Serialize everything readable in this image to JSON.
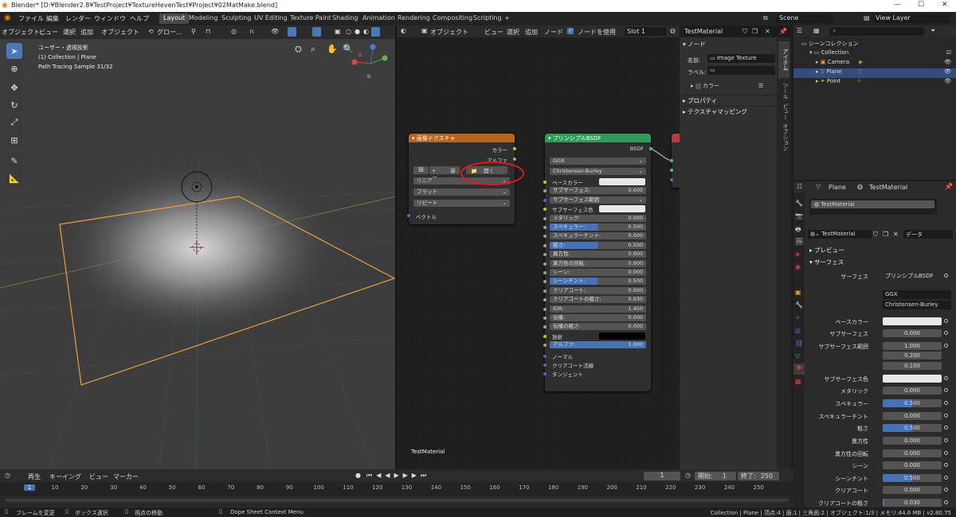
{
  "title_bar": {
    "title": "Blender* [D:¥Blender2.8¥TestProject¥TextureHevenTest¥Project¥02MatMake.blend]",
    "minimize": "—",
    "maximize": "☐",
    "close": "✕"
  },
  "menu": {
    "items": [
      "ファイル",
      "編集",
      "レンダー",
      "ウィンドウ",
      "ヘルプ"
    ],
    "workspaces": [
      "Layout",
      "Modeling",
      "Sculpting",
      "UV Editing",
      "Texture Paint",
      "Shading",
      "Animation",
      "Rendering",
      "Compositing",
      "Scripting",
      "+"
    ],
    "scene": "Scene",
    "view_layer": "View Layer"
  },
  "viewport": {
    "header": {
      "mode": "オブジェクト...",
      "view": "ビュー",
      "select": "選択",
      "add": "追加",
      "object": "オブジェクト",
      "orientation": "グロー..."
    },
    "overlay_lines": [
      "ユーザー・透視投影",
      "(1) Collection | Plane",
      "Path Tracing Sample 31/32"
    ]
  },
  "node_editor": {
    "header": {
      "type": "オブジェクト",
      "view": "ビュー",
      "select": "選択",
      "add": "追加",
      "node": "ノード",
      "use_nodes": "ノードを使用",
      "slot": "Slot 1",
      "material": "TestMaterial"
    },
    "footer_label": "TestMaterial",
    "image_texture_node": {
      "title": "画像テクスチャ",
      "out_color": "カラー",
      "out_alpha": "アルファ",
      "new_btn": "新規",
      "open_btn": "開く",
      "interpolation": "リニア",
      "projection": "フラット",
      "extension": "リピート",
      "in_vector": "ベクトル"
    },
    "bsdf_node": {
      "title": "プリンシプルBSDF",
      "out": "BSDF",
      "distribution": "GGX",
      "subsurface_method": "Christensen-Burley",
      "rows": [
        {
          "label": "ベースカラー",
          "value": "",
          "kind": "color"
        },
        {
          "label": "サブサーフェス:",
          "value": "0.000",
          "kind": "num"
        },
        {
          "label": "サブサーフェス範囲",
          "value": "",
          "kind": "drop"
        },
        {
          "label": "サブサーフェス色",
          "value": "",
          "kind": "color"
        },
        {
          "label": "メタリック:",
          "value": "0.000",
          "kind": "num"
        },
        {
          "label": "スペキュラー:",
          "value": "0.500",
          "kind": "bar"
        },
        {
          "label": "スペキュラーチント:",
          "value": "0.000",
          "kind": "num"
        },
        {
          "label": "粗さ:",
          "value": "0.500",
          "kind": "bar"
        },
        {
          "label": "異方性:",
          "value": "0.000",
          "kind": "num"
        },
        {
          "label": "異方性の回転:",
          "value": "0.000",
          "kind": "num"
        },
        {
          "label": "シーン:",
          "value": "0.000",
          "kind": "num"
        },
        {
          "label": "シーンチント:",
          "value": "0.500",
          "kind": "bar"
        },
        {
          "label": "クリアコート:",
          "value": "0.000",
          "kind": "num"
        },
        {
          "label": "クリアコートの粗さ:",
          "value": "0.030",
          "kind": "num"
        },
        {
          "label": "IOR:",
          "value": "1.450",
          "kind": "num"
        },
        {
          "label": "伝播:",
          "value": "0.000",
          "kind": "num"
        },
        {
          "label": "伝播の粗さ:",
          "value": "0.000",
          "kind": "num"
        },
        {
          "label": "放射",
          "value": "",
          "kind": "black"
        },
        {
          "label": "アルファ:",
          "value": "1.000",
          "kind": "full"
        }
      ],
      "inputs_plain": [
        "ノーマル",
        "クリアコート法線",
        "タンジェント"
      ]
    }
  },
  "n_panel": {
    "section": "ノード",
    "name_label": "名前:",
    "name_value": "Image Texture",
    "label_label": "ラベル:",
    "color": "カラー",
    "properties": "プロパティ",
    "texture_mapping": "テクスチャマッピング",
    "tabs": [
      "アイテム",
      "ツール",
      "ビュー",
      "オプション"
    ]
  },
  "outliner": {
    "root": "シーンコレクション",
    "rows": [
      {
        "name": "Collection"
      },
      {
        "name": "Camera"
      },
      {
        "name": "Plane"
      },
      {
        "name": "Point"
      }
    ]
  },
  "properties": {
    "object": "Plane",
    "material": "TestMaterial",
    "slot_item": "TestMaterial",
    "mat_name": "TestMaterial",
    "data": "データ",
    "preview": "プレビュー",
    "surface_section": "サーフェス",
    "surface_label": "サーフェス",
    "surface_value": "プリンシプルBSDF",
    "distribution": "GGX",
    "method": "Christensen-Burley",
    "rows": [
      {
        "label": "ベースカラー",
        "value": ""
      },
      {
        "label": "サブサーフェス",
        "value": "0.000"
      },
      {
        "label": "サブサーフェス範囲",
        "value": "1.000"
      },
      {
        "label": "",
        "value": "0.200"
      },
      {
        "label": "",
        "value": "0.100"
      },
      {
        "label": "サブサーフェス色",
        "value": ""
      },
      {
        "label": "メタリック",
        "value": "0.000"
      },
      {
        "label": "スペキュラー",
        "value": "0.500"
      },
      {
        "label": "スペキュラーチント",
        "value": "0.000"
      },
      {
        "label": "粗さ",
        "value": "0.500"
      },
      {
        "label": "異方性",
        "value": "0.000"
      },
      {
        "label": "異方性の回転",
        "value": "0.000"
      },
      {
        "label": "シーン",
        "value": "0.000"
      },
      {
        "label": "シーンチント",
        "value": "0.500"
      },
      {
        "label": "クリアコート",
        "value": "0.000"
      },
      {
        "label": "クリアコートの粗さ",
        "value": "0.030"
      }
    ]
  },
  "timeline": {
    "playback": "再生",
    "keying": "キーイング",
    "view": "ビュー",
    "marker": "マーカー",
    "current": "1",
    "start_label": "開始:",
    "start": "1",
    "end_label": "終了:",
    "end": "250",
    "ticks": [
      "1",
      "10",
      "20",
      "30",
      "40",
      "50",
      "60",
      "70",
      "80",
      "90",
      "100",
      "110",
      "120",
      "130",
      "140",
      "150",
      "160",
      "170",
      "180",
      "190",
      "200",
      "210",
      "220",
      "230",
      "240",
      "250"
    ]
  },
  "status": {
    "left1": "フレームを変更",
    "left2": "ボックス選択",
    "left3": "視点の移動",
    "center": "Dope Sheet Context Menu",
    "right": "Collection | Plane | 頂点:4 | 面:1 | 三角面:2 | オブジェクト:1/3 | メモリ:44.6 MB | v2.80.75"
  }
}
